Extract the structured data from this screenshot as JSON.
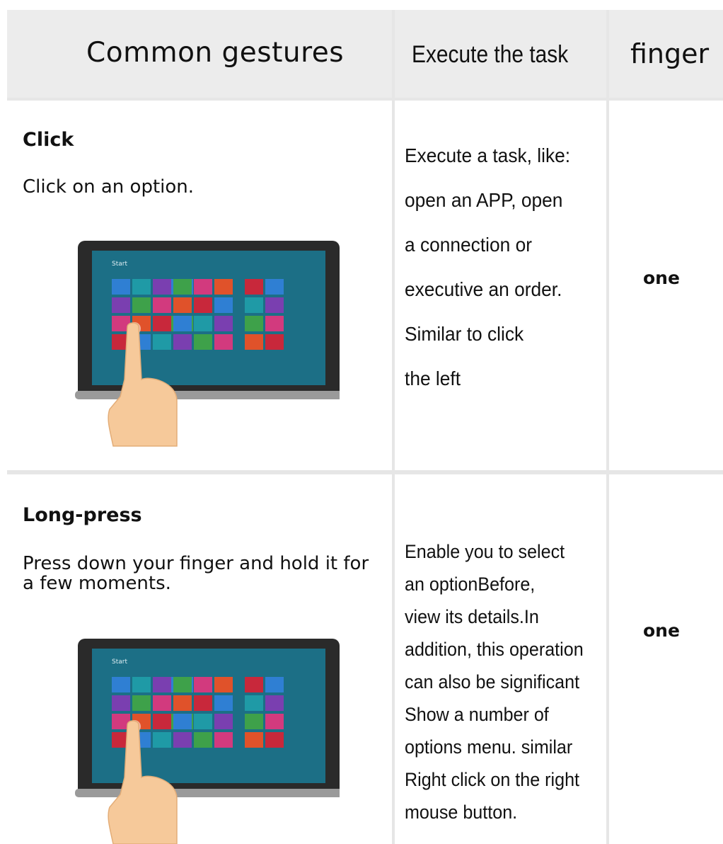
{
  "header": {
    "gestures": "Common gestures",
    "task": "Execute the task",
    "finger": "finger"
  },
  "rows": [
    {
      "name": "Click",
      "description": "Click on an option.",
      "task_lines": [
        "Execute a task, like:",
        " open an APP, open",
        " a connection or",
        "executive an order.",
        "Similar to click",
        " the left"
      ],
      "finger": "one",
      "screen_label": "Start"
    },
    {
      "name": "Long-press",
      "description": "Press down your finger and hold it for a few moments.",
      "task_lines": [
        "Enable you to select",
        "an optionBefore,",
        "view its details.In",
        "addition, this operation",
        "can also be significant",
        "Show a number of",
        "options menu. similar",
        "Right click on the right",
        "mouse button."
      ],
      "finger": "one",
      "screen_label": "Start"
    }
  ],
  "colors": {
    "grid": "#e6e6e6",
    "header_bg": "#ececec",
    "tablet_bezel": "#2a2a2a",
    "screen_bg": "#1c6f86",
    "hand": "#f6c99a"
  },
  "tile_colors": [
    "#2f7fd3",
    "#3ea14a",
    "#c8283b",
    "#7a3fb0",
    "#e0522a",
    "#1f9aa6",
    "#d23a7e"
  ]
}
